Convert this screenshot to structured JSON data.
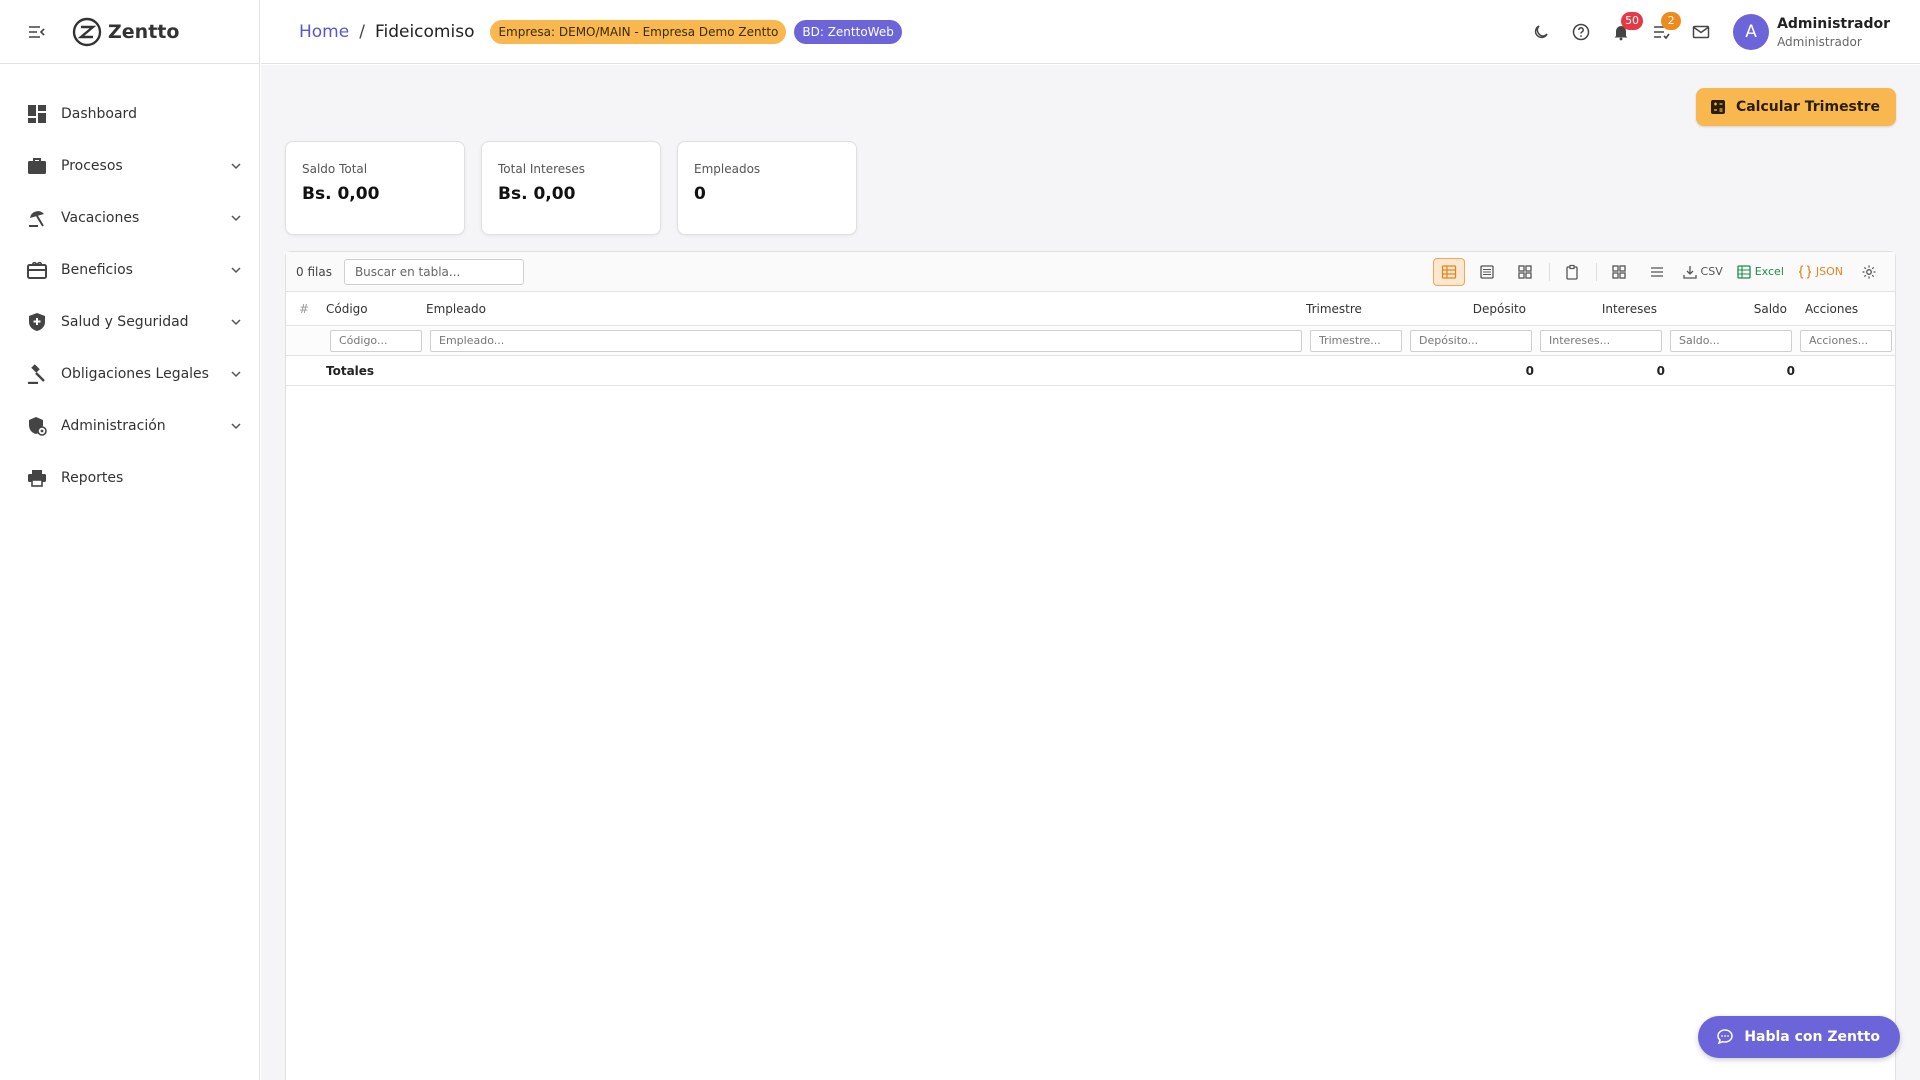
{
  "app": {
    "name": "Zentto"
  },
  "sidebar": {
    "items": [
      {
        "label": "Dashboard",
        "icon": "dashboard-icon",
        "expandable": false
      },
      {
        "label": "Procesos",
        "icon": "briefcase-icon",
        "expandable": true
      },
      {
        "label": "Vacaciones",
        "icon": "beach-icon",
        "expandable": true
      },
      {
        "label": "Beneficios",
        "icon": "gift-card-icon",
        "expandable": true
      },
      {
        "label": "Salud y Seguridad",
        "icon": "shield-icon",
        "expandable": true
      },
      {
        "label": "Obligaciones Legales",
        "icon": "gavel-icon",
        "expandable": true
      },
      {
        "label": "Administración",
        "icon": "admin-shield-icon",
        "expandable": true
      },
      {
        "label": "Reportes",
        "icon": "print-icon",
        "expandable": false
      }
    ]
  },
  "header": {
    "breadcrumb_home": "Home",
    "breadcrumb_sep": "/",
    "breadcrumb_current": "Fideicomiso",
    "chip_empresa": "Empresa: DEMO/MAIN - Empresa Demo Zentto",
    "chip_bd": "BD: ZenttoWeb",
    "notifications_count": "50",
    "tasks_count": "2",
    "avatar_letter": "A",
    "user_name": "Administrador",
    "user_role": "Administrador"
  },
  "actions": {
    "calc_label": "Calcular Trimestre"
  },
  "cards": [
    {
      "label": "Saldo Total",
      "value": "Bs. 0,00"
    },
    {
      "label": "Total Intereses",
      "value": "Bs. 0,00"
    },
    {
      "label": "Empleados",
      "value": "0"
    }
  ],
  "grid": {
    "rows_count": "0 filas",
    "search_placeholder": "Buscar en tabla...",
    "export_csv": "CSV",
    "export_excel": "Excel",
    "export_json": "JSON",
    "columns": {
      "index": "#",
      "codigo": "Código",
      "empleado": "Empleado",
      "trimestre": "Trimestre",
      "deposito": "Depósito",
      "intereses": "Intereses",
      "saldo": "Saldo",
      "acciones": "Acciones"
    },
    "filters": {
      "codigo": "Código...",
      "empleado": "Empleado...",
      "trimestre": "Trimestre...",
      "deposito": "Depósito...",
      "intereses": "Intereses...",
      "saldo": "Saldo...",
      "acciones": "Acciones..."
    },
    "totals": {
      "label": "Totales",
      "deposito": "0",
      "intereses": "0",
      "saldo": "0"
    }
  },
  "chat": {
    "label": "Habla con Zentto"
  },
  "colors": {
    "accent": "#6c64d9",
    "warning": "#f8b84f",
    "danger": "#e63946"
  }
}
